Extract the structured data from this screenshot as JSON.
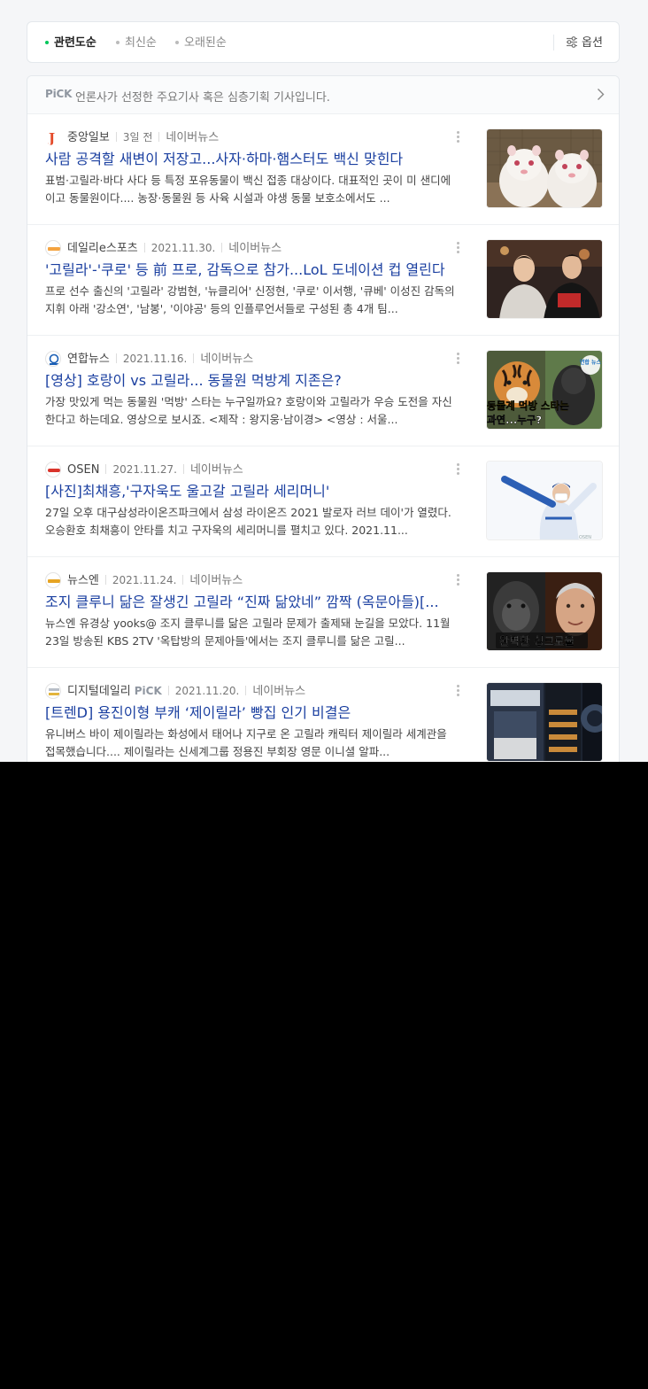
{
  "sort": {
    "relevance": "관련도순",
    "latest": "최신순",
    "oldest": "오래된순",
    "options": "옵션"
  },
  "pick": {
    "badge": "PiCK",
    "text": "언론사가 선정한 주요기사 혹은 심층기획 기사입니다."
  },
  "colors": {
    "accent_green": "#03c75a",
    "title_blue": "#1a3fa0"
  },
  "articles": [
    {
      "press": "중앙일보",
      "date": "3일 전",
      "source": "네이버뉴스",
      "title": "사람 공격할 새변이 저장고...사자·하마·햄스터도 백신 맞힌다",
      "desc": "표범·고릴라·바다 사다 등 특정 포유동물이 백신 접종 대상이다. 대표적인 곳이 미 샌디에이고 동물원이다.... 농장·동물원 등 사육 시설과 야생 동물 보호소에서도 ...",
      "thumb": "two-white-ferrets"
    },
    {
      "press": "데일리e스포츠",
      "date": "2021.11.30.",
      "source": "네이버뉴스",
      "title": "'고릴라'-'쿠로' 등 前 프로, 감독으로 참가...LoL 도네이션 컵 열린다",
      "desc": "프로 선수 출신의 '고릴라' 강범현, '뉴클리어' 신정현, '쿠로' 이서행, '큐베' 이성진 감독의 지휘 아래 '강소연', '남봉', '이야공' 등의 인플루언서들로 구성된 총 4개 팀...",
      "thumb": "two-men-portrait"
    },
    {
      "press": "연합뉴스",
      "date": "2021.11.16.",
      "source": "네이버뉴스",
      "title": "[영상] 호랑이 vs 고릴라... 동물원 먹방계 지존은?",
      "desc": "가장 맛있게 먹는 동물원 '먹방' 스타는 누구일까요? 호랑이와 고릴라가 우승 도전을 자신한다고 하는데요. 영상으로 보시죠. <제작 : 왕지웅·남이경> <영상 : 서울...",
      "thumb": "tiger-gorilla",
      "thumb_caption_1": "동물계 먹방 스타는",
      "thumb_caption_2": "과연...누구?",
      "thumb_badge": "연합 뉴스"
    },
    {
      "press": "OSEN",
      "date": "2021.11.27.",
      "source": "네이버뉴스",
      "title": "[사진]최채흥,'구자욱도 울고갈 고릴라 세리머니'",
      "desc": "27일 오후 대구삼성라이온즈파크에서 삼성 라이온즈 2021 발로자 러브 데이'가 열렸다. 오승환호 최채흥이 안타를 치고 구자욱의 세리머니를 펼치고 있다. 2021.11...",
      "thumb": "baseball-player-celebration"
    },
    {
      "press": "뉴스엔",
      "date": "2021.11.24.",
      "source": "네이버뉴스",
      "title": "조지 클루니 닮은 잘생긴 고릴라 “진짜 닮았네” 깜짝 (옥문아들)[...",
      "desc": "뉴스엔 유경상 yooks@ 조지 클루니를 닮은 고릴라 문제가 출제돼 눈길을 모았다. 11월 23일 방송된 KBS 2TV '옥탑방의 문제아들'에서는 조지 클루니를 닮은 고릴...",
      "thumb": "gorilla-and-man",
      "thumb_caption": "완벽한 싱크로율"
    },
    {
      "press": "디지털데일리",
      "press_badge": "PiCK",
      "date": "2021.11.20.",
      "source": "네이버뉴스",
      "title": "[트렌D] 용진이형 부캐 ‘제이릴라’ 빵집 인기 비결은",
      "desc": "유니버스 바이 제이릴라는 화성에서 태어나 지구로 온 고릴라 캐릭터 제이릴라 세계관을 접목했습니다.... 제이릴라는 신세계그룹 정용진 부회장 영문 이니셜 알파...",
      "thumb": "bakery-interior"
    }
  ]
}
